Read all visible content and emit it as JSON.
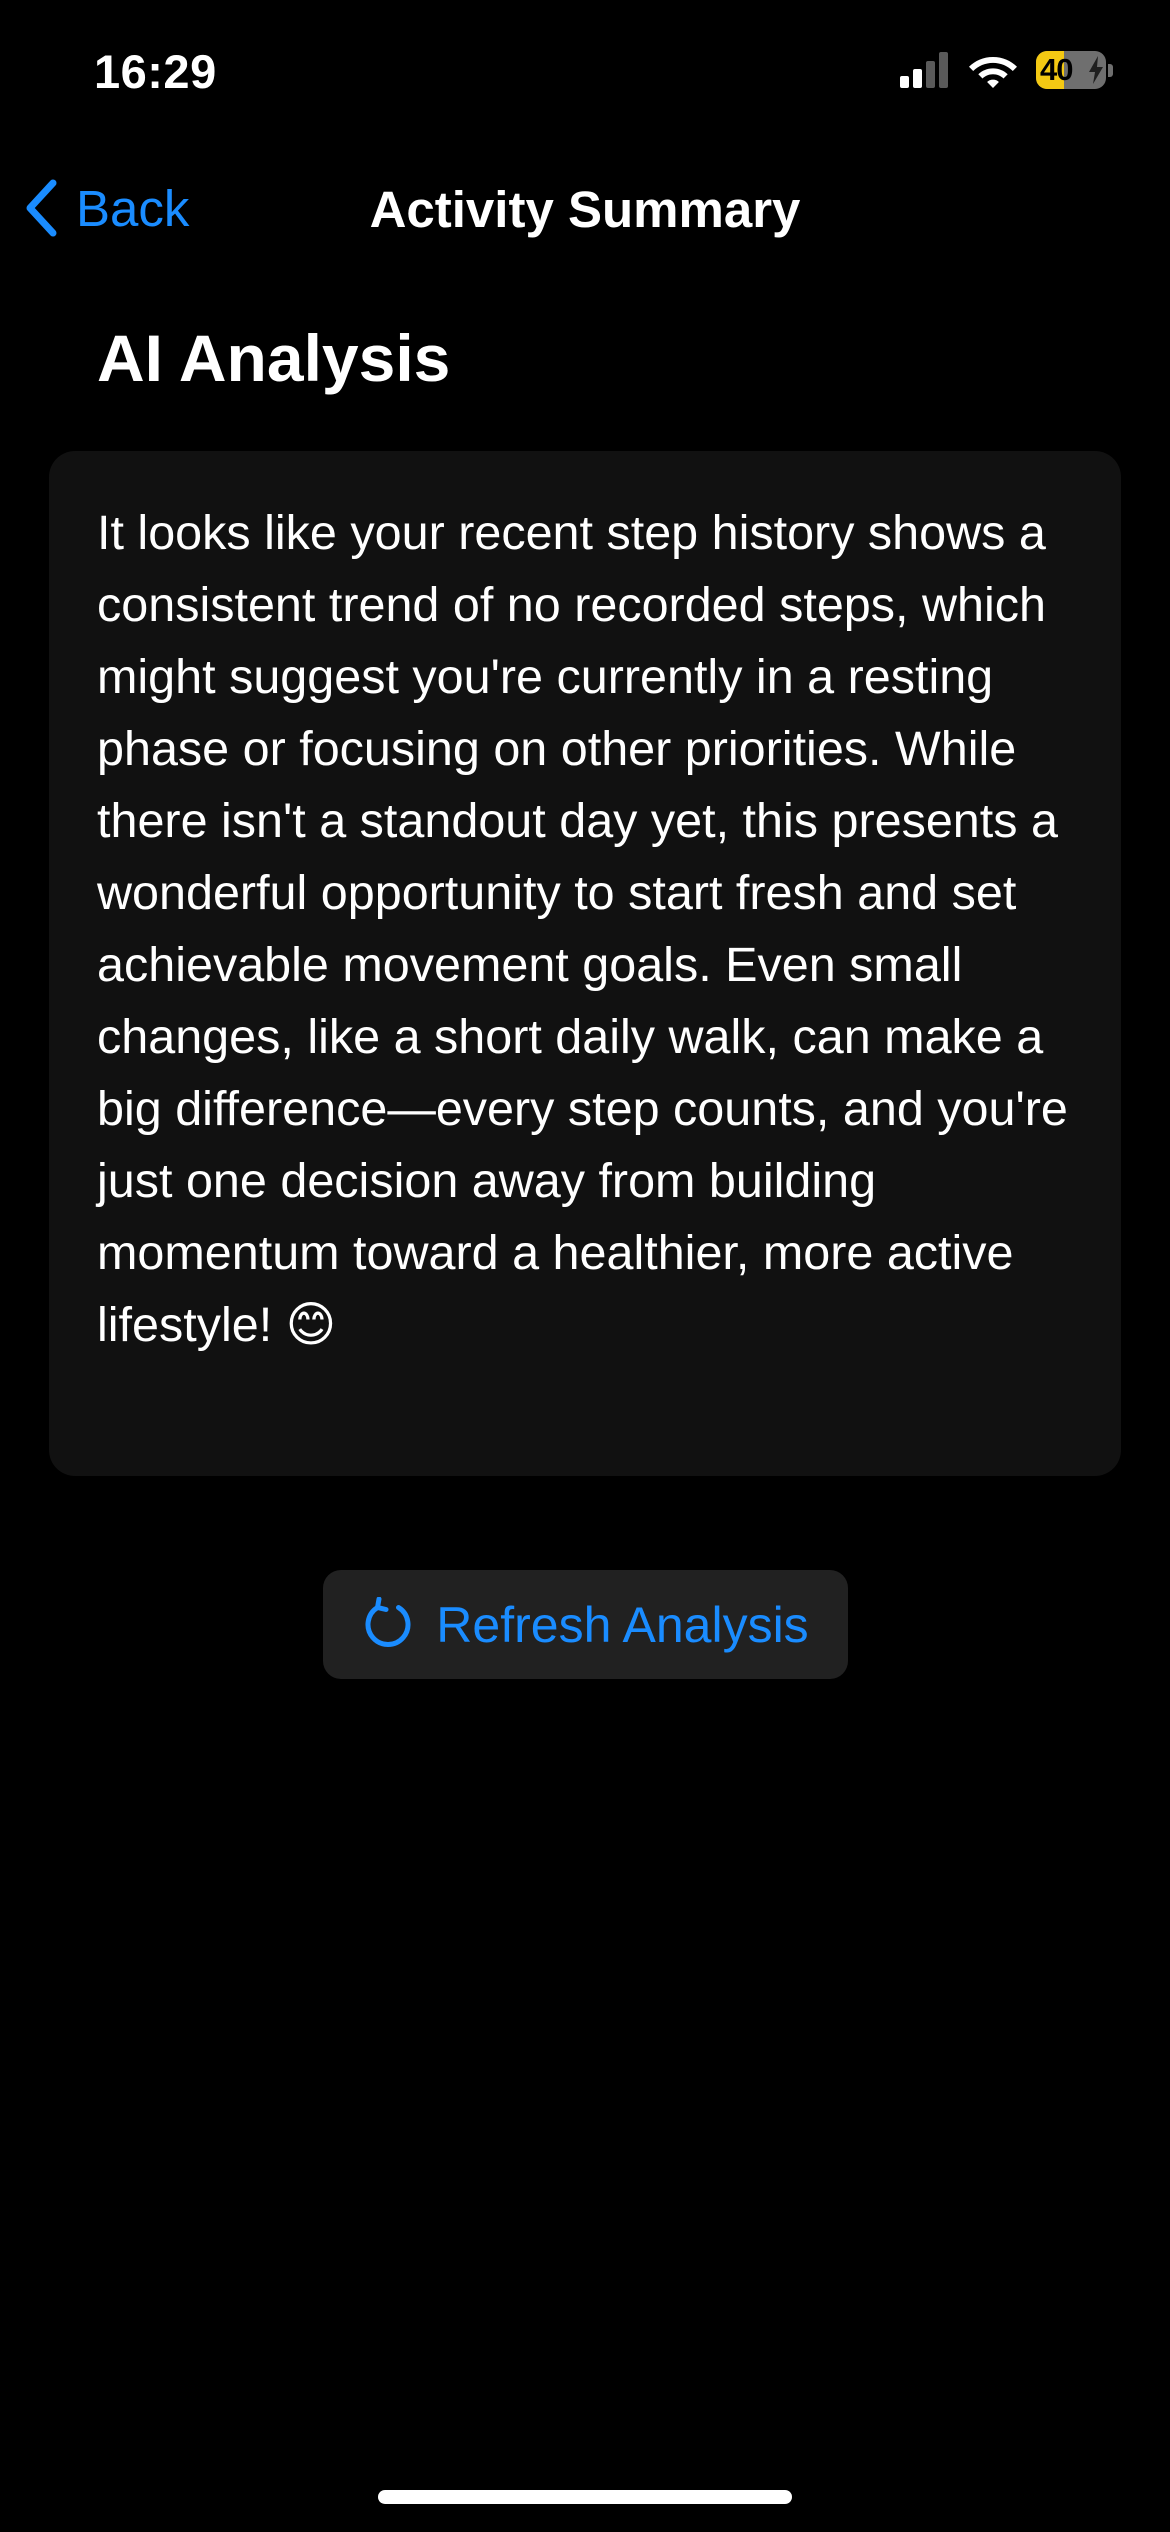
{
  "status_bar": {
    "time": "16:29",
    "battery_level": "40",
    "battery_charging": true,
    "signal_bars_active": 2,
    "signal_bars_total": 4,
    "icons": [
      "signal-icon",
      "wifi-icon",
      "battery-icon",
      "charging-bolt-icon"
    ]
  },
  "nav": {
    "back_label": "Back",
    "back_icon": "chevron-left-icon",
    "title": "Activity Summary"
  },
  "section": {
    "title": "AI Analysis"
  },
  "analysis": {
    "text": "It looks like your recent step history shows a consistent trend of no recorded steps, which might suggest you're currently in a resting phase or focusing on other priorities. While there isn't a standout day yet, this presents a wonderful opportunity to start fresh and set achievable movement goals. Even small changes, like a short daily walk, can make a big difference—every step counts, and you're just one decision away from building momentum toward a healthier, more active lifestyle! 😊"
  },
  "refresh": {
    "label": "Refresh Analysis",
    "icon": "refresh-icon"
  },
  "colors": {
    "background": "#000000",
    "card": "#111111",
    "button": "#212121",
    "accent": "#1a8cff",
    "battery": "#f4c913"
  }
}
